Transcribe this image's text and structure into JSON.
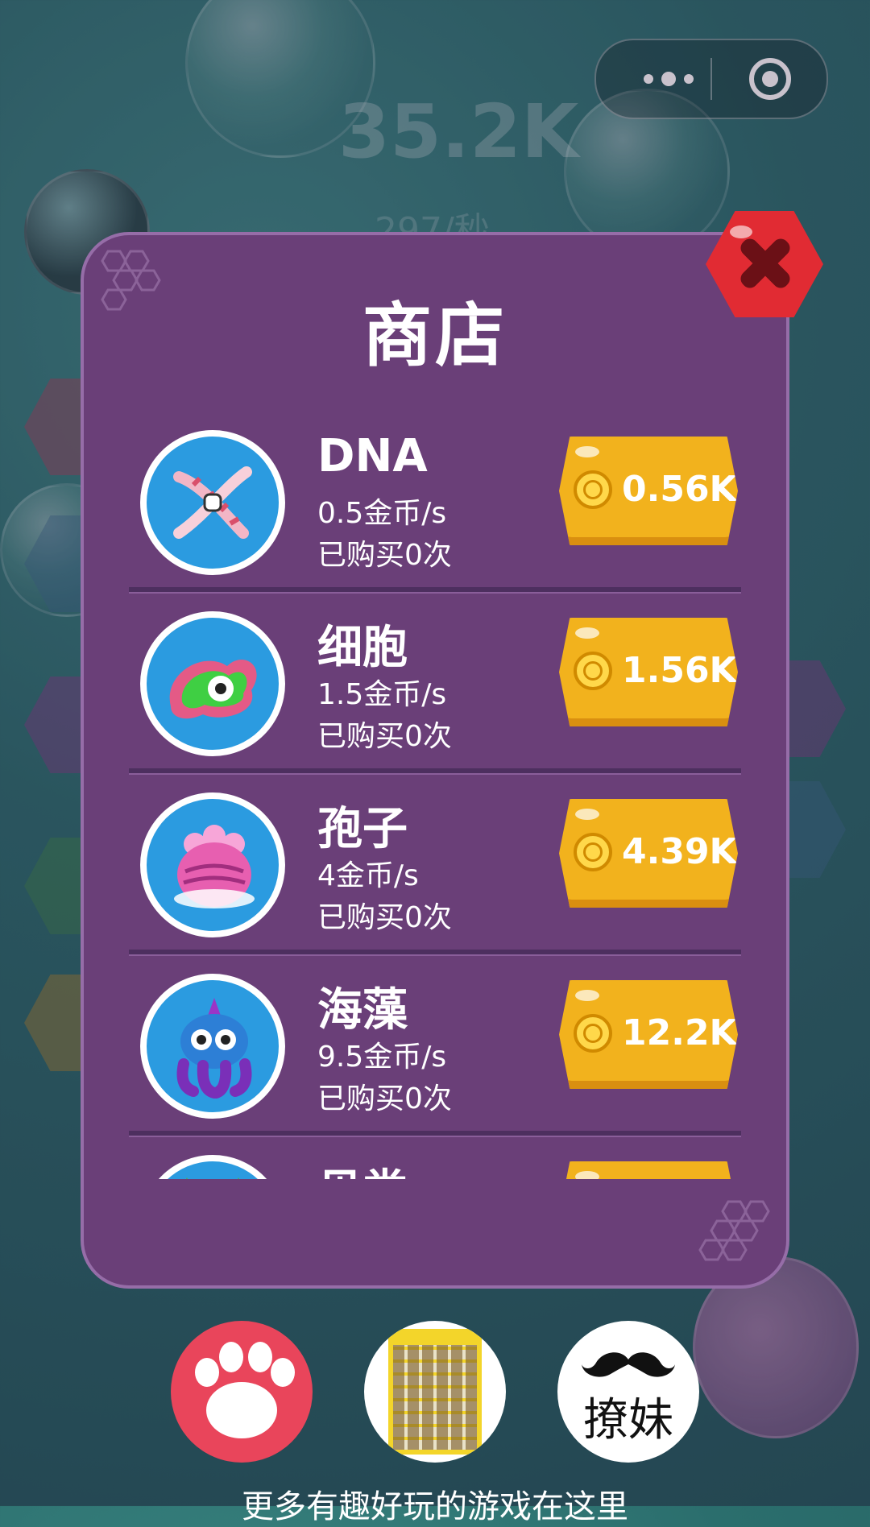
{
  "background": {
    "score": "35.2K",
    "rate": "297/秒"
  },
  "capsule": {
    "more_icon": "more-dots-icon",
    "close_icon": "target-circle-icon"
  },
  "shop": {
    "title": "商店",
    "close_icon": "close-x-icon",
    "items": [
      {
        "name": "DNA",
        "rate": "0.5金币/s",
        "bought": "已购买0次",
        "price": "0.56K",
        "icon": "dna-icon"
      },
      {
        "name": "细胞",
        "rate": "1.5金币/s",
        "bought": "已购买0次",
        "price": "1.56K",
        "icon": "cell-icon"
      },
      {
        "name": "孢子",
        "rate": "4金币/s",
        "bought": "已购买0次",
        "price": "4.39K",
        "icon": "spore-icon"
      },
      {
        "name": "海藻",
        "rate": "9.5金币/s",
        "bought": "已购买0次",
        "price": "12.2K",
        "icon": "seaweed-icon"
      },
      {
        "name": "贝类",
        "rate": "",
        "bought": "",
        "price": "",
        "icon": "shellfish-icon"
      }
    ]
  },
  "promos": [
    {
      "icon": "paw-icon"
    },
    {
      "icon": "poster-icon"
    },
    {
      "icon": "mustache-icon",
      "label": "撩妹"
    }
  ],
  "footer": "更多有趣好玩的游戏在这里",
  "colors": {
    "panel": "#6a3f78",
    "price_button": "#f2b21d",
    "close": "#e12b33",
    "avatar_bg": "#2b9be0"
  }
}
